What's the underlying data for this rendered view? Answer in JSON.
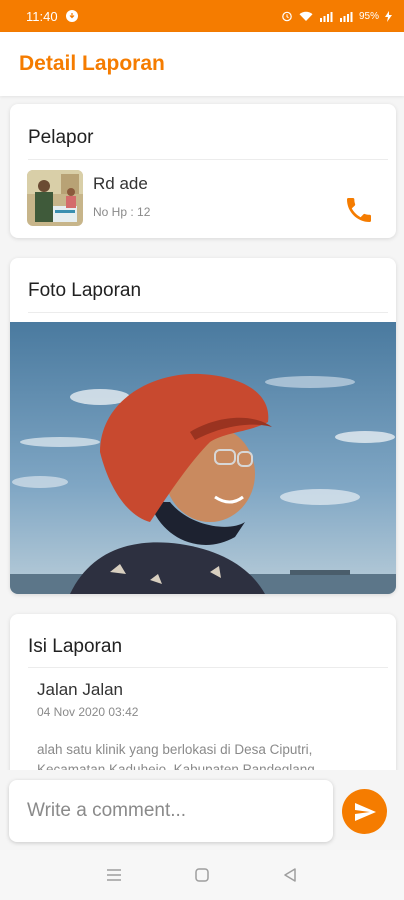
{
  "status_bar": {
    "time": "11:40",
    "battery": "95%"
  },
  "app_bar": {
    "title": "Detail Laporan"
  },
  "reporter_card": {
    "title": "Pelapor",
    "name": "Rd ade",
    "phone": "No Hp : 12",
    "call_icon": "phone-icon"
  },
  "photo_card": {
    "title": "Foto Laporan"
  },
  "content_card": {
    "title": "Isi Laporan",
    "report_title": "Jalan Jalan",
    "report_date": "04 Nov 2020 03:42",
    "report_body": "alah satu klinik yang berlokasi di Desa Ciputri, Kecamatan Kaduhejo, Kabupaten Pandeglang"
  },
  "comment": {
    "placeholder": "Write a comment...",
    "send_icon": "send-icon"
  },
  "colors": {
    "accent": "#f57c00",
    "card": "#ffffff",
    "background": "#f5f5f5"
  },
  "nav": {
    "icons": [
      "menu-icon",
      "home-square-icon",
      "back-triangle-icon"
    ]
  }
}
